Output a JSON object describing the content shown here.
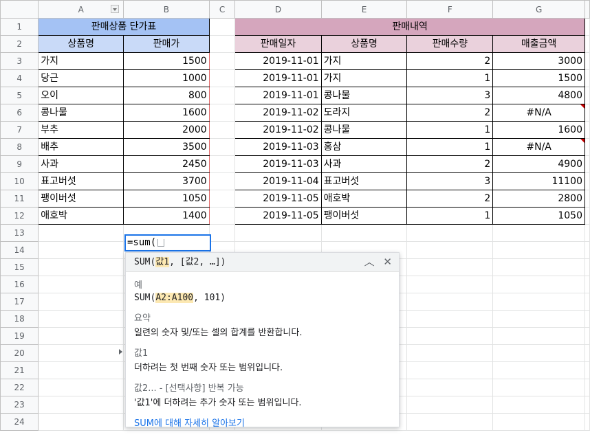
{
  "columns": [
    "A",
    "B",
    "C",
    "D",
    "E",
    "F",
    "G"
  ],
  "rows": [
    "1",
    "2",
    "3",
    "4",
    "5",
    "6",
    "7",
    "8",
    "9",
    "10",
    "11",
    "12",
    "13",
    "14",
    "15",
    "16",
    "17",
    "18",
    "19",
    "20",
    "21",
    "22",
    "23",
    "24"
  ],
  "table1": {
    "title": "판매상품 단가표",
    "headers": [
      "상품명",
      "판매가"
    ],
    "rows": [
      [
        "가지",
        "1500"
      ],
      [
        "당근",
        "1000"
      ],
      [
        "오이",
        "800"
      ],
      [
        "콩나물",
        "1600"
      ],
      [
        "부추",
        "2000"
      ],
      [
        "배추",
        "3500"
      ],
      [
        "사과",
        "2450"
      ],
      [
        "표고버섯",
        "3700"
      ],
      [
        "팽이버섯",
        "1050"
      ],
      [
        "애호박",
        "1400"
      ]
    ]
  },
  "table2": {
    "title": "판매내역",
    "headers": [
      "판매일자",
      "상품명",
      "판매수량",
      "매출금액"
    ],
    "rows": [
      [
        "2019-11-01",
        "가지",
        "2",
        "3000"
      ],
      [
        "2019-11-01",
        "가지",
        "1",
        "1500"
      ],
      [
        "2019-11-01",
        "콩나물",
        "3",
        "4800"
      ],
      [
        "2019-11-02",
        "도라지",
        "2",
        "#N/A"
      ],
      [
        "2019-11-02",
        "콩나물",
        "1",
        "1600"
      ],
      [
        "2019-11-03",
        "홍삼",
        "1",
        "#N/A"
      ],
      [
        "2019-11-03",
        "사과",
        "2",
        "4900"
      ],
      [
        "2019-11-04",
        "표고버섯",
        "3",
        "11100"
      ],
      [
        "2019-11-05",
        "애호박",
        "2",
        "2800"
      ],
      [
        "2019-11-05",
        "팽이버섯",
        "1",
        "1050"
      ]
    ]
  },
  "editor": {
    "value": "=sum("
  },
  "help": {
    "sig_fn": "SUM(",
    "sig_arg1": "값1",
    "sig_rest": ", [값2, …])",
    "example_label": "예",
    "example_fn": "SUM(",
    "example_range": "A2:A100",
    "example_rest": ", 101)",
    "summary_label": "요약",
    "summary_text": "일련의 숫자 및/또는 셀의 합계를 반환합니다.",
    "arg1_label": "값1",
    "arg1_text": "더하려는 첫 번째 숫자 또는 범위입니다.",
    "arg2_label": "값2... - [선택사항] 반복 가능",
    "arg2_text": "'값1'에 더하려는 추가 숫자 또는 범위입니다.",
    "learn_more": "SUM에 대해 자세히 알아보기",
    "collapse_glyph": "︿",
    "close_glyph": "✕"
  },
  "colors": {
    "accent": "#1a73e8",
    "error_marker": "#cc0000",
    "header_blue": "#a4c2f4",
    "header_pink": "#d5a6bd"
  }
}
